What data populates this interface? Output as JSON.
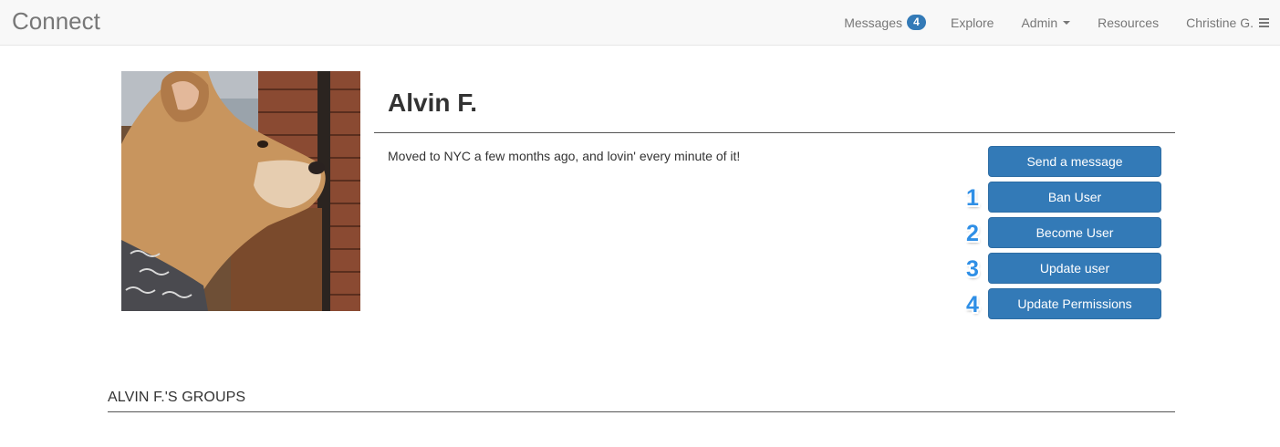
{
  "navbar": {
    "brand": "Connect",
    "items": [
      {
        "label": "Messages",
        "badge": "4"
      },
      {
        "label": "Explore"
      },
      {
        "label": "Admin",
        "icon": "caret-down-icon"
      },
      {
        "label": "Resources"
      },
      {
        "label": "Christine G.",
        "icon": "hamburger-menu-icon"
      }
    ]
  },
  "profile": {
    "name": "Alvin F.",
    "bio": "Moved to NYC a few months ago, and lovin' every minute of it!",
    "avatar_alt": "Profile photo of a dog wearing a bandana",
    "actions": {
      "send_message": "Send a message",
      "ban_user": "Ban User",
      "become_user": "Become User",
      "update_user": "Update user",
      "update_permissions": "Update Permissions"
    },
    "step_numbers": [
      "1",
      "2",
      "3",
      "4"
    ]
  },
  "groups": {
    "heading": "ALVIN F.'S GROUPS"
  },
  "colors": {
    "primary": "#337ab7",
    "navbar_bg": "#f8f8f8",
    "nav_text": "#777777",
    "annotation": "#2f8fe6"
  }
}
